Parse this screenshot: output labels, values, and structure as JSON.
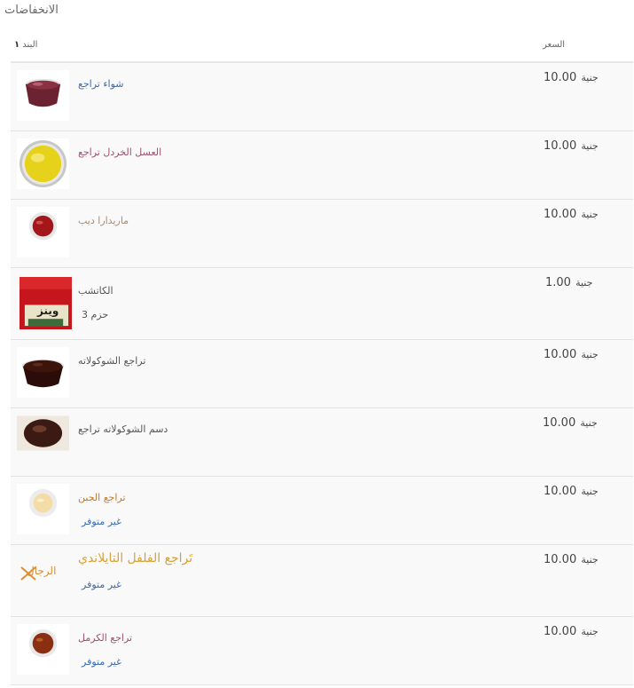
{
  "page": {
    "title": "الانخفاضات"
  },
  "header": {
    "item_label": "البند",
    "item_count": "١",
    "price_label": "السعر"
  },
  "items": [
    {
      "name": "شواء تراجع",
      "name_color": "#3b6bb0",
      "price": "10.00",
      "currency": "جنية",
      "sub": "",
      "image": "bbq-sauce-cup"
    },
    {
      "name": "العسل الخردل تراجع",
      "name_color": "#a0526b",
      "price": "10.00",
      "currency": "جنية",
      "sub": "",
      "image": "honey-mustard-cup"
    },
    {
      "name": "ماريدارا ديب",
      "name_color": "#b08a6a",
      "price": "10.00",
      "currency": "جنية",
      "sub": "",
      "image": "marinara-cup"
    },
    {
      "name": "الكاتشب",
      "name_color": "#555555",
      "price": "1.00",
      "currency": "جنية",
      "sub": "حزم 3",
      "image": "ketchup-packet",
      "packet_brand": "وينز"
    },
    {
      "name": "تراجع الشوكولاته",
      "name_color": "#555555",
      "price": "10.00",
      "currency": "جنية",
      "sub": "",
      "image": "chocolate-cup"
    },
    {
      "name": "دسم الشوكولاته تراجع",
      "name_color": "#555555",
      "price": "10.00",
      "currency": "جنية",
      "sub": "",
      "image": "chocolate-fudge"
    },
    {
      "name": "تراجع الجبن",
      "name_color": "#c07a2a",
      "price": "10.00",
      "currency": "جنية",
      "sub": "غير متوفر",
      "image": "cheese-cup"
    },
    {
      "name": "تَراجع الفلفل التايلاندي",
      "name_color": "#d8a23a",
      "price": "10.00",
      "currency": "جنية",
      "sub": "غير متوفر",
      "image": "logo",
      "logo_text": "الرجال"
    },
    {
      "name": "تراجع الكرمل",
      "name_color": "#a0526b",
      "price": "10.00",
      "currency": "جنية",
      "sub": "غير متوفر",
      "image": "caramel-cup"
    }
  ]
}
